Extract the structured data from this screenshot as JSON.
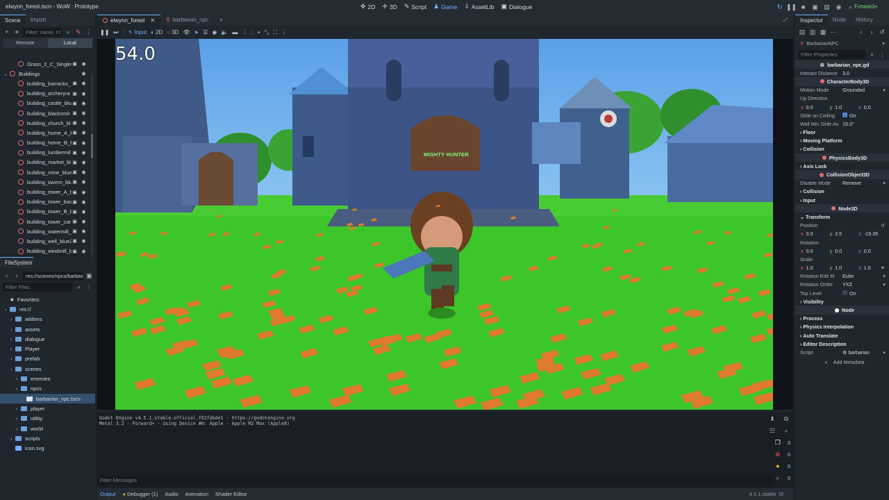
{
  "window": {
    "title": "elwynn_forest.tscn - WoW : Prototype"
  },
  "main_screens": [
    {
      "label": "2D",
      "glyph": "✜",
      "active": false
    },
    {
      "label": "3D",
      "glyph": "✛",
      "active": false
    },
    {
      "label": "Script",
      "glyph": "✎",
      "active": false
    },
    {
      "label": "Game",
      "glyph": "♟",
      "active": true
    },
    {
      "label": "AssetLib",
      "glyph": "⇩",
      "active": false
    },
    {
      "label": "Dialogue",
      "glyph": "▣",
      "active": false
    }
  ],
  "renderer": "Forward+",
  "scene_dock": {
    "tabs": [
      "Scene",
      "Import"
    ],
    "filter_placeholder": "Filter: name, t:t",
    "remote_label": "Remote",
    "local_label": "Local",
    "items": [
      {
        "label": "Grass_2_C_Singles",
        "indent": 2
      },
      {
        "label": "Buildings",
        "indent": 1
      },
      {
        "label": "building_barracks_",
        "indent": 2
      },
      {
        "label": "building_archeryra",
        "indent": 2
      },
      {
        "label": "building_castle_blu",
        "indent": 2
      },
      {
        "label": "building_blacksmit",
        "indent": 2
      },
      {
        "label": "building_church_bl",
        "indent": 2
      },
      {
        "label": "building_home_A_b",
        "indent": 2
      },
      {
        "label": "building_home_B_b",
        "indent": 2
      },
      {
        "label": "building_lumbermil",
        "indent": 2
      },
      {
        "label": "building_market_bl",
        "indent": 2
      },
      {
        "label": "building_mine_blue",
        "indent": 2
      },
      {
        "label": "building_tavern_blu",
        "indent": 2
      },
      {
        "label": "building_tower_A_b",
        "indent": 2
      },
      {
        "label": "building_tower_bas",
        "indent": 2
      },
      {
        "label": "building_tower_B_b",
        "indent": 2
      },
      {
        "label": "building_tower_cat",
        "indent": 2
      },
      {
        "label": "building_watermill_",
        "indent": 2
      },
      {
        "label": "building_well_blue2",
        "indent": 2
      },
      {
        "label": "building_windmill_b",
        "indent": 2
      }
    ]
  },
  "filesystem": {
    "title": "FileSystem",
    "path": "res://scenes/npcs/barbari",
    "filter_placeholder": "Filter Files",
    "favorites": "Favorites:",
    "items": [
      {
        "label": "res://",
        "indent": 1,
        "type": "folder"
      },
      {
        "label": "addons",
        "indent": 2,
        "type": "folder"
      },
      {
        "label": "assets",
        "indent": 2,
        "type": "folder"
      },
      {
        "label": "dialogue",
        "indent": 2,
        "type": "folder"
      },
      {
        "label": "Player",
        "indent": 2,
        "type": "folder"
      },
      {
        "label": "prefab",
        "indent": 2,
        "type": "folder"
      },
      {
        "label": "scenes",
        "indent": 2,
        "type": "folder"
      },
      {
        "label": "enemies",
        "indent": 3,
        "type": "folder"
      },
      {
        "label": "npcs",
        "indent": 3,
        "type": "folder"
      },
      {
        "label": "barbarian_npc.tscn",
        "indent": 4,
        "type": "scene",
        "selected": true
      },
      {
        "label": "player",
        "indent": 3,
        "type": "folder"
      },
      {
        "label": "utility",
        "indent": 3,
        "type": "folder"
      },
      {
        "label": "world",
        "indent": 3,
        "type": "folder"
      },
      {
        "label": "scripts",
        "indent": 2,
        "type": "folder"
      },
      {
        "label": "icon.svg",
        "indent": 2,
        "type": "file"
      }
    ]
  },
  "editor_tabs": [
    {
      "label": "elwynn_forest",
      "active": true
    },
    {
      "label": "barbarian_npc",
      "active": false
    }
  ],
  "game_toolbar": {
    "input_label": "Input",
    "mode2d_label": "2D",
    "mode3d_label": "3D"
  },
  "game": {
    "fps": "54.0",
    "npc_name": "MIGHTY HUNTER"
  },
  "output": {
    "lines": "Godot Engine v4.5.1.stable.official.f62fdbde1 - https://godotengine.org\nMetal 3.2 - Forward+ - Using Device #0: Apple - Apple M2 Max (Apple8)",
    "filter_placeholder": "Filter Messages",
    "counts": {
      "messages": "3",
      "errors": "0",
      "warnings": "0",
      "info": "0"
    }
  },
  "bottom_tabs": [
    "Output",
    "Debugger (1)",
    "Audio",
    "Animation",
    "Shader Editor"
  ],
  "version": "4.5.1.stable",
  "inspector": {
    "tabs": [
      "Inspector",
      "Node",
      "History"
    ],
    "node_name": "BarbarianNPC",
    "filter_placeholder": "Filter Properties",
    "script_file": "barbarian_npc.gd",
    "interact_distance_label": "Interact Distance",
    "interact_distance": "3.0",
    "class1": "CharacterBody3D",
    "motion_mode_label": "Motion Mode",
    "motion_mode": "Grounded",
    "up_direction_label": "Up Direction",
    "up": {
      "x": "0.0",
      "y": "1.0",
      "z": "0.0"
    },
    "slide_on_ceiling_label": "Slide on Ceiling",
    "slide_on_ceiling": "On",
    "wall_min_slide_label": "Wall Min Slide An",
    "wall_min_slide": "15.0",
    "wall_min_slide_unit": "°",
    "floor_label": "Floor",
    "moving_platform_label": "Moving Platform",
    "collision_label": "Collision",
    "class2": "PhysicsBody3D",
    "axis_lock_label": "Axis Lock",
    "class3": "CollisionObject3D",
    "disable_mode_label": "Disable Mode",
    "disable_mode": "Remove",
    "collision2_label": "Collision",
    "input_label": "Input",
    "class4": "Node3D",
    "transform_label": "Transform",
    "position_label": "Position",
    "position": {
      "x": "0.0",
      "y": "2.5",
      "z": "-19.35"
    },
    "rotation_label": "Rotation",
    "rotation": {
      "x": "0.0",
      "y": "0.0",
      "z": "0.0"
    },
    "scale_label": "Scale",
    "scale": {
      "x": "1.0",
      "y": "1.0",
      "z": "1.0"
    },
    "rotation_edit_label": "Rotation Edit M",
    "rotation_edit": "Euler",
    "rotation_order_label": "Rotation Order",
    "rotation_order": "YXZ",
    "top_level_label": "Top Level",
    "top_level": "On",
    "visibility_label": "Visibility",
    "class5": "Node",
    "process_label": "Process",
    "physics_interp_label": "Physics Interpolation",
    "auto_translate_label": "Auto Translate",
    "editor_desc_label": "Editor Description",
    "script_label": "Script",
    "script_value": "barbarian",
    "add_metadata_label": "Add Metadata"
  },
  "colors": {
    "accent": "#6eb2ff",
    "grass": "#3cc62a",
    "tile": "#e07a2e",
    "node_red": "#e56b6b"
  }
}
